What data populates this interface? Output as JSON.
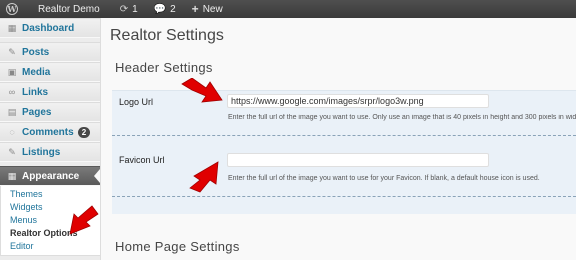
{
  "adminbar": {
    "site_name": "Realtor Demo",
    "updates_count": "1",
    "comments_count": "2",
    "new_label": "New"
  },
  "sidebar": {
    "dashboard": "Dashboard",
    "posts": "Posts",
    "media": "Media",
    "links": "Links",
    "pages": "Pages",
    "comments": "Comments",
    "comments_badge": "2",
    "listings": "Listings",
    "appearance": "Appearance",
    "submenu": [
      "Themes",
      "Widgets",
      "Menus",
      "Realtor Options",
      "Editor"
    ]
  },
  "page": {
    "title": "Realtor Settings",
    "header_section": "Header Settings",
    "home_section": "Home Page Settings",
    "logo_label": "Logo Url",
    "logo_value": "https://www.google.com/images/srpr/logo3w.png",
    "logo_desc": "Enter the full url of the image you want to use. Only use an image that is 40 pixels in height and 300 pixels in wid",
    "favicon_label": "Favicon Url",
    "favicon_value": "",
    "favicon_desc": "Enter the full url of the image you want to use for your Favicon. If blank, a default house icon is used."
  },
  "colors": {
    "adminbar_bg": "#464646",
    "link_blue": "#21759b",
    "panel_bg": "#eaf1f8",
    "arrow_red": "#e00000"
  },
  "icons": [
    "wordpress-logo-icon",
    "updates-icon",
    "comments-icon",
    "plus-icon",
    "dashboard-icon",
    "posts-icon",
    "media-icon",
    "links-icon",
    "pages-icon",
    "comments-menu-icon",
    "listings-icon",
    "appearance-icon"
  ]
}
